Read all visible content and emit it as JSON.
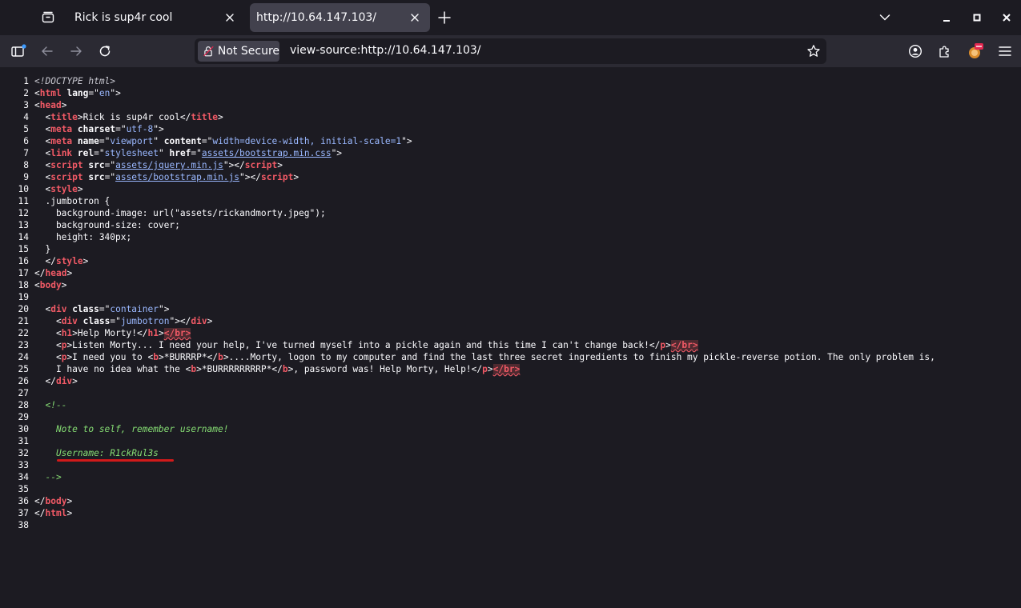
{
  "browser": {
    "tabs": [
      {
        "title": "Rick is sup4r cool",
        "active": false
      },
      {
        "title": "http://10.64.147.103/",
        "active": true
      }
    ],
    "urlbar": {
      "security_label": "Not Secure",
      "url": "view-source:http://10.64.147.103/"
    }
  },
  "icons": {
    "tab_list": "tab-list-icon",
    "close_tab": "close-icon",
    "new_tab": "plus-icon",
    "list_all_tabs": "chevron-down-icon",
    "minimize": "minimize-icon",
    "maximize": "maximize-icon",
    "close_window": "close-icon",
    "sidebar": "sidebar-icon",
    "back": "back-arrow-icon",
    "forward": "forward-arrow-icon",
    "reload": "reload-icon",
    "lock": "broken-lock-icon",
    "bookmark": "star-icon",
    "account": "account-icon",
    "extensions": "puzzle-icon",
    "extension_badge": "extension-icon",
    "menu": "hamburger-menu-icon"
  },
  "colors": {
    "tag": "#f25a66",
    "attribute_value": "#9ab8ff",
    "comment": "#86de74",
    "annotation_underline": "#d11a1a"
  },
  "source_lines": [
    {
      "n": "1",
      "tokens": [
        {
          "t": "doc",
          "v": "<!DOCTYPE html>"
        }
      ]
    },
    {
      "n": "2",
      "tokens": [
        {
          "t": "txt",
          "v": "<"
        },
        {
          "t": "tag",
          "v": "html"
        },
        {
          "t": "txt",
          "v": " "
        },
        {
          "t": "attr",
          "v": "lang"
        },
        {
          "t": "txt",
          "v": "=\""
        },
        {
          "t": "val",
          "v": "en"
        },
        {
          "t": "txt",
          "v": "\">"
        }
      ]
    },
    {
      "n": "3",
      "tokens": [
        {
          "t": "txt",
          "v": "<"
        },
        {
          "t": "tag",
          "v": "head"
        },
        {
          "t": "txt",
          "v": ">"
        }
      ]
    },
    {
      "n": "4",
      "tokens": [
        {
          "t": "txt",
          "v": "  <"
        },
        {
          "t": "tag",
          "v": "title"
        },
        {
          "t": "txt",
          "v": ">Rick is sup4r cool</"
        },
        {
          "t": "tag",
          "v": "title"
        },
        {
          "t": "txt",
          "v": ">"
        }
      ]
    },
    {
      "n": "5",
      "tokens": [
        {
          "t": "txt",
          "v": "  <"
        },
        {
          "t": "tag",
          "v": "meta"
        },
        {
          "t": "txt",
          "v": " "
        },
        {
          "t": "attr",
          "v": "charset"
        },
        {
          "t": "txt",
          "v": "=\""
        },
        {
          "t": "val",
          "v": "utf-8"
        },
        {
          "t": "txt",
          "v": "\">"
        }
      ]
    },
    {
      "n": "6",
      "tokens": [
        {
          "t": "txt",
          "v": "  <"
        },
        {
          "t": "tag",
          "v": "meta"
        },
        {
          "t": "txt",
          "v": " "
        },
        {
          "t": "attr",
          "v": "name"
        },
        {
          "t": "txt",
          "v": "=\""
        },
        {
          "t": "val",
          "v": "viewport"
        },
        {
          "t": "txt",
          "v": "\" "
        },
        {
          "t": "attr",
          "v": "content"
        },
        {
          "t": "txt",
          "v": "=\""
        },
        {
          "t": "val",
          "v": "width=device-width, initial-scale=1"
        },
        {
          "t": "txt",
          "v": "\">"
        }
      ]
    },
    {
      "n": "7",
      "tokens": [
        {
          "t": "txt",
          "v": "  <"
        },
        {
          "t": "tag",
          "v": "link"
        },
        {
          "t": "txt",
          "v": " "
        },
        {
          "t": "attr",
          "v": "rel"
        },
        {
          "t": "txt",
          "v": "=\""
        },
        {
          "t": "val",
          "v": "stylesheet"
        },
        {
          "t": "txt",
          "v": "\" "
        },
        {
          "t": "attr",
          "v": "href"
        },
        {
          "t": "txt",
          "v": "=\""
        },
        {
          "t": "link",
          "v": "assets/bootstrap.min.css"
        },
        {
          "t": "txt",
          "v": "\">"
        }
      ]
    },
    {
      "n": "8",
      "tokens": [
        {
          "t": "txt",
          "v": "  <"
        },
        {
          "t": "tag",
          "v": "script"
        },
        {
          "t": "txt",
          "v": " "
        },
        {
          "t": "attr",
          "v": "src"
        },
        {
          "t": "txt",
          "v": "=\""
        },
        {
          "t": "link",
          "v": "assets/jquery.min.js"
        },
        {
          "t": "txt",
          "v": "\"></"
        },
        {
          "t": "tag",
          "v": "script"
        },
        {
          "t": "txt",
          "v": ">"
        }
      ]
    },
    {
      "n": "9",
      "tokens": [
        {
          "t": "txt",
          "v": "  <"
        },
        {
          "t": "tag",
          "v": "script"
        },
        {
          "t": "txt",
          "v": " "
        },
        {
          "t": "attr",
          "v": "src"
        },
        {
          "t": "txt",
          "v": "=\""
        },
        {
          "t": "link",
          "v": "assets/bootstrap.min.js"
        },
        {
          "t": "txt",
          "v": "\"></"
        },
        {
          "t": "tag",
          "v": "script"
        },
        {
          "t": "txt",
          "v": ">"
        }
      ]
    },
    {
      "n": "10",
      "tokens": [
        {
          "t": "txt",
          "v": "  <"
        },
        {
          "t": "tag",
          "v": "style"
        },
        {
          "t": "txt",
          "v": ">"
        }
      ]
    },
    {
      "n": "11",
      "tokens": [
        {
          "t": "txt",
          "v": "  .jumbotron {"
        }
      ]
    },
    {
      "n": "12",
      "tokens": [
        {
          "t": "txt",
          "v": "    background-image: url(\"assets/rickandmorty.jpeg\");"
        }
      ]
    },
    {
      "n": "13",
      "tokens": [
        {
          "t": "txt",
          "v": "    background-size: cover;"
        }
      ]
    },
    {
      "n": "14",
      "tokens": [
        {
          "t": "txt",
          "v": "    height: 340px;"
        }
      ]
    },
    {
      "n": "15",
      "tokens": [
        {
          "t": "txt",
          "v": "  }"
        }
      ]
    },
    {
      "n": "16",
      "tokens": [
        {
          "t": "txt",
          "v": "  </"
        },
        {
          "t": "tag",
          "v": "style"
        },
        {
          "t": "txt",
          "v": ">"
        }
      ]
    },
    {
      "n": "17",
      "tokens": [
        {
          "t": "txt",
          "v": "</"
        },
        {
          "t": "tag",
          "v": "head"
        },
        {
          "t": "txt",
          "v": ">"
        }
      ]
    },
    {
      "n": "18",
      "tokens": [
        {
          "t": "txt",
          "v": "<"
        },
        {
          "t": "tag",
          "v": "body"
        },
        {
          "t": "txt",
          "v": ">"
        }
      ]
    },
    {
      "n": "19",
      "tokens": []
    },
    {
      "n": "20",
      "tokens": [
        {
          "t": "txt",
          "v": "  <"
        },
        {
          "t": "tag",
          "v": "div"
        },
        {
          "t": "txt",
          "v": " "
        },
        {
          "t": "attr",
          "v": "class"
        },
        {
          "t": "txt",
          "v": "=\""
        },
        {
          "t": "val",
          "v": "container"
        },
        {
          "t": "txt",
          "v": "\">"
        }
      ]
    },
    {
      "n": "21",
      "tokens": [
        {
          "t": "txt",
          "v": "    <"
        },
        {
          "t": "tag",
          "v": "div"
        },
        {
          "t": "txt",
          "v": " "
        },
        {
          "t": "attr",
          "v": "class"
        },
        {
          "t": "txt",
          "v": "=\""
        },
        {
          "t": "val",
          "v": "jumbotron"
        },
        {
          "t": "txt",
          "v": "\"></"
        },
        {
          "t": "tag",
          "v": "div"
        },
        {
          "t": "txt",
          "v": ">"
        }
      ]
    },
    {
      "n": "22",
      "tokens": [
        {
          "t": "txt",
          "v": "    <"
        },
        {
          "t": "tag",
          "v": "h1"
        },
        {
          "t": "txt",
          "v": ">Help Morty!</"
        },
        {
          "t": "tag",
          "v": "h1"
        },
        {
          "t": "txt",
          "v": ">"
        },
        {
          "t": "err",
          "v": "</"
        },
        {
          "t": "err",
          "v": "br"
        },
        {
          "t": "err",
          "v": ">"
        }
      ]
    },
    {
      "n": "23",
      "tokens": [
        {
          "t": "txt",
          "v": "    <"
        },
        {
          "t": "tag",
          "v": "p"
        },
        {
          "t": "txt",
          "v": ">Listen Morty... I need your help, I've turned myself into a pickle again and this time I can't change back!</"
        },
        {
          "t": "tag",
          "v": "p"
        },
        {
          "t": "txt",
          "v": ">"
        },
        {
          "t": "err",
          "v": "</"
        },
        {
          "t": "err",
          "v": "br"
        },
        {
          "t": "err",
          "v": ">"
        }
      ]
    },
    {
      "n": "24",
      "tokens": [
        {
          "t": "txt",
          "v": "    <"
        },
        {
          "t": "tag",
          "v": "p"
        },
        {
          "t": "txt",
          "v": ">I need you to <"
        },
        {
          "t": "tag",
          "v": "b"
        },
        {
          "t": "txt",
          "v": ">*BURRRP*</"
        },
        {
          "t": "tag",
          "v": "b"
        },
        {
          "t": "txt",
          "v": ">....Morty, logon to my computer and find the last three secret ingredients to finish my pickle-reverse potion. The only problem is,"
        }
      ]
    },
    {
      "n": "25",
      "tokens": [
        {
          "t": "txt",
          "v": "    I have no idea what the <"
        },
        {
          "t": "tag",
          "v": "b"
        },
        {
          "t": "txt",
          "v": ">*BURRRRRRRRP*</"
        },
        {
          "t": "tag",
          "v": "b"
        },
        {
          "t": "txt",
          "v": ">, password was! Help Morty, Help!</"
        },
        {
          "t": "tag",
          "v": "p"
        },
        {
          "t": "txt",
          "v": ">"
        },
        {
          "t": "err",
          "v": "</"
        },
        {
          "t": "err",
          "v": "br"
        },
        {
          "t": "err",
          "v": ">"
        }
      ]
    },
    {
      "n": "26",
      "tokens": [
        {
          "t": "txt",
          "v": "  </"
        },
        {
          "t": "tag",
          "v": "div"
        },
        {
          "t": "txt",
          "v": ">"
        }
      ]
    },
    {
      "n": "27",
      "tokens": []
    },
    {
      "n": "28",
      "tokens": [
        {
          "t": "cmt",
          "v": "  <!--"
        }
      ]
    },
    {
      "n": "29",
      "tokens": []
    },
    {
      "n": "30",
      "tokens": [
        {
          "t": "cmt",
          "v": "    Note to self, remember username!"
        }
      ]
    },
    {
      "n": "31",
      "tokens": []
    },
    {
      "n": "32",
      "tokens": [
        {
          "t": "cmt",
          "v": "    Username: R1ckRul3s"
        }
      ]
    },
    {
      "n": "33",
      "tokens": []
    },
    {
      "n": "34",
      "tokens": [
        {
          "t": "cmt",
          "v": "  -->"
        }
      ]
    },
    {
      "n": "35",
      "tokens": []
    },
    {
      "n": "36",
      "tokens": [
        {
          "t": "txt",
          "v": "</"
        },
        {
          "t": "tag",
          "v": "body"
        },
        {
          "t": "txt",
          "v": ">"
        }
      ]
    },
    {
      "n": "37",
      "tokens": [
        {
          "t": "txt",
          "v": "</"
        },
        {
          "t": "tag",
          "v": "html"
        },
        {
          "t": "txt",
          "v": ">"
        }
      ]
    },
    {
      "n": "38",
      "tokens": []
    }
  ]
}
